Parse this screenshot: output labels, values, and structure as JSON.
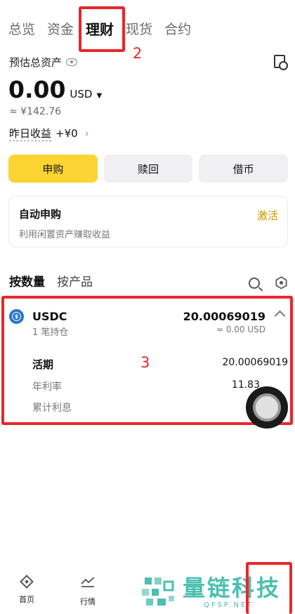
{
  "tabs": [
    {
      "label": "总览",
      "active": false
    },
    {
      "label": "资金",
      "active": false
    },
    {
      "label": "理财",
      "active": true
    },
    {
      "label": "现货",
      "active": false
    },
    {
      "label": "合约",
      "active": false
    }
  ],
  "annotations": {
    "marker_2": "2",
    "marker_3": "3",
    "color": "#e8262b"
  },
  "assets": {
    "label": "预估总资产",
    "amount": "0.00",
    "currency": "USD",
    "approx": "≈ ¥142.76",
    "yesterday_label": "昨日收益",
    "yesterday_value": "+¥0"
  },
  "actions": {
    "subscribe": "申购",
    "redeem": "赎回",
    "borrow": "借币"
  },
  "auto_subscribe": {
    "title": "自动申购",
    "subtitle": "利用闲置资产赚取收益",
    "action": "激活"
  },
  "sub_tabs": [
    {
      "label": "按数量",
      "active": true
    },
    {
      "label": "按产品",
      "active": false
    }
  ],
  "coin": {
    "name": "USDC",
    "positions": "1 笔持仓",
    "total": "20.00069019",
    "usd": "≈ 0.00 USD",
    "icon_letter": "$",
    "details": [
      {
        "label": "活期",
        "value": "20.00069019"
      },
      {
        "label": "年利率",
        "value": "11.83"
      },
      {
        "label": "累计利息",
        "value": ""
      }
    ]
  },
  "bottom_nav": [
    {
      "label": "首页",
      "icon": "diamond-home-icon"
    },
    {
      "label": "行情",
      "icon": "trend-chart-icon"
    }
  ],
  "watermark": {
    "text": "量链科技",
    "url": "QFSP.NET"
  },
  "colors": {
    "accent": "#fcd535",
    "action": "#c99400",
    "usdc": "#2775ca",
    "watermark": "#4bbfb0"
  }
}
